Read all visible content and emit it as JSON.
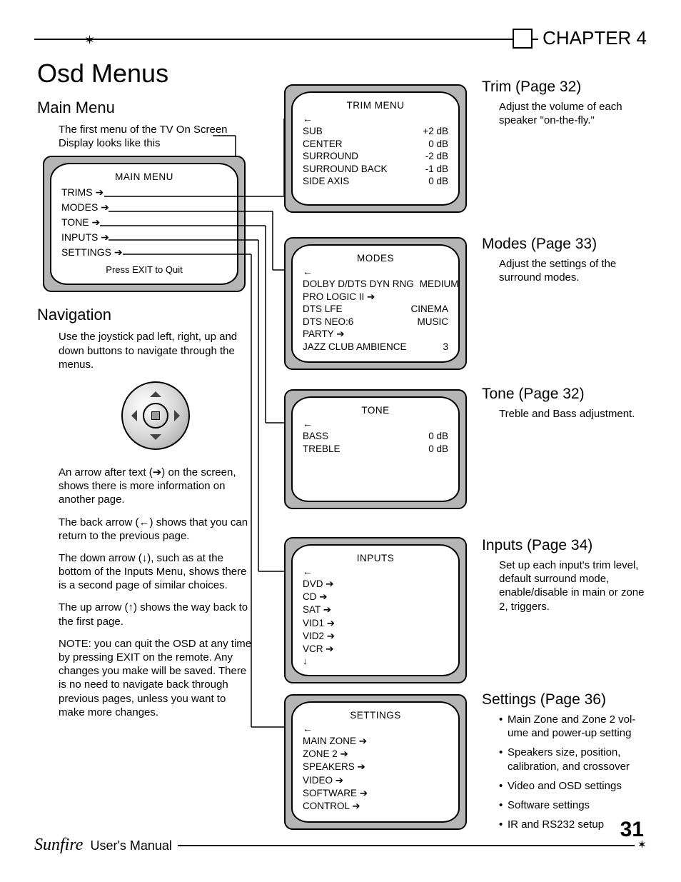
{
  "header": {
    "chapter": "CHAPTER 4"
  },
  "title": "Osd Menus",
  "left": {
    "main_menu_heading": "Main Menu",
    "main_menu_intro": "The first menu of the TV On Screen Display looks like this",
    "nav_heading": "Navigation",
    "nav_p1": "Use the joystick pad left, right, up and down buttons to navigate through the menus.",
    "nav_p2": "An arrow after text (➔) on the screen, shows there is more infor­mation on another page.",
    "nav_p3": "The back arrow (←) shows that you can return to the previous page.",
    "nav_p4": "The down arrow (↓), such as at the bottom of the Inputs Menu, shows there is a second page of similar choices.",
    "nav_p5": "The up arrow (↑) shows the way back to the first page.",
    "nav_p6": "NOTE: you can quit the OSD at any time by pressing EXIT on the remote. Any changes you make will be saved. There is no need to navigate back through previous pages, unless you want to make more changes."
  },
  "tv_main": {
    "title": "MAIN MENU",
    "items": [
      "TRIMS",
      "MODES",
      "TONE",
      "INPUTS",
      "SETTINGS"
    ],
    "footer": "Press EXIT to Quit"
  },
  "tv_trim": {
    "title": "TRIM  MENU",
    "rows": [
      {
        "lbl": "SUB",
        "val": "+2  dB"
      },
      {
        "lbl": "CENTER",
        "val": "0  dB"
      },
      {
        "lbl": "SURROUND",
        "val": "-2  dB"
      },
      {
        "lbl": "SURROUND BACK",
        "val": "-1  dB"
      },
      {
        "lbl": "SIDE AXIS",
        "val": "0  dB"
      }
    ]
  },
  "tv_modes": {
    "title": "MODES",
    "rows": [
      {
        "lbl": "DOLBY D/DTS DYN RNG",
        "val": "MEDIUM"
      },
      {
        "lbl": "PRO LOGIC II",
        "val": "",
        "arrow": true
      },
      {
        "lbl": "DTS LFE",
        "val": "CINEMA"
      },
      {
        "lbl": "DTS NEO:6",
        "val": "MUSIC"
      },
      {
        "lbl": "PARTY",
        "val": "",
        "arrow": true
      },
      {
        "lbl": "JAZZ CLUB AMBIENCE",
        "val": "3"
      }
    ]
  },
  "tv_tone": {
    "title": "TONE",
    "rows": [
      {
        "lbl": "BASS",
        "val": "0  dB"
      },
      {
        "lbl": "TREBLE",
        "val": "0  dB"
      }
    ]
  },
  "tv_inputs": {
    "title": "INPUTS",
    "items": [
      "DVD",
      "CD",
      "SAT",
      "VID1",
      "VID2",
      "VCR"
    ]
  },
  "tv_settings": {
    "title": "SETTINGS",
    "items": [
      "MAIN ZONE",
      "ZONE 2",
      "SPEAKERS",
      "VIDEO",
      "SOFTWARE",
      "CONTROL"
    ]
  },
  "right": {
    "trim": {
      "h": "Trim (Page 32)",
      "p": "Adjust the volume of each speaker \"on-the-fly.\""
    },
    "modes": {
      "h": "Modes (Page 33)",
      "p": "Adjust the settings of the surround modes."
    },
    "tone": {
      "h": "Tone (Page 32)",
      "p": "Treble and Bass adjust­ment."
    },
    "inputs": {
      "h": "Inputs (Page 34)",
      "p": "Set up each input's trim lev­el, default surround mode, enable/disable in main or zone 2, triggers."
    },
    "settings": {
      "h": "Settings (Page 36)",
      "bullets": [
        "Main Zone and Zone 2 vol­ume and power-up setting",
        "Speakers size, position, calibration, and crossover",
        "Video and OSD settings",
        "Software settings",
        "IR and RS232 setup"
      ]
    }
  },
  "footer": {
    "brand": "Sunfire",
    "label": "User's Manual",
    "page": "31"
  }
}
